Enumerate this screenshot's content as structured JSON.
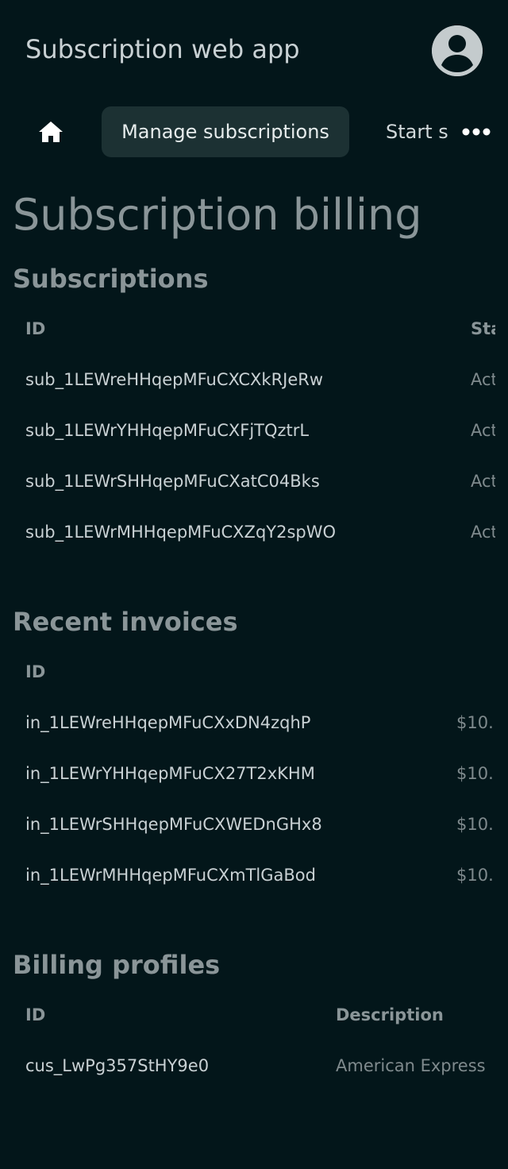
{
  "header": {
    "app_title": "Subscription web app",
    "avatar_icon": "account-circle-icon"
  },
  "nav": {
    "home_icon": "home-icon",
    "active_tab": "Manage subscriptions",
    "next_tab": "Start s",
    "more_icon": "more-horizontal-icon"
  },
  "page": {
    "title": "Subscription billing"
  },
  "subscriptions": {
    "title": "Subscriptions",
    "columns": [
      "ID",
      "Sta"
    ],
    "rows": [
      {
        "id": "sub_1LEWreHHqepMFuCXCXkRJeRw",
        "status": "Act"
      },
      {
        "id": "sub_1LEWrYHHqepMFuCXFjTQztrL",
        "status": "Act"
      },
      {
        "id": "sub_1LEWrSHHqepMFuCXatC04Bks",
        "status": "Act"
      },
      {
        "id": "sub_1LEWrMHHqepMFuCXZqY2spWO",
        "status": "Act"
      }
    ]
  },
  "invoices": {
    "title": "Recent invoices",
    "columns": [
      "ID"
    ],
    "rows": [
      {
        "id": "in_1LEWreHHqepMFuCXxDN4zqhP",
        "amount": "$10."
      },
      {
        "id": "in_1LEWrYHHqepMFuCX27T2xKHM",
        "amount": "$10."
      },
      {
        "id": "in_1LEWrSHHqepMFuCXWEDnGHx8",
        "amount": "$10."
      },
      {
        "id": "in_1LEWrMHHqepMFuCXmTlGaBod",
        "amount": "$10."
      }
    ]
  },
  "profiles": {
    "title": "Billing profiles",
    "columns": [
      "ID",
      "Description"
    ],
    "rows": [
      {
        "id": "cus_LwPg357StHY9e0",
        "description": "American Express"
      }
    ]
  },
  "colors": {
    "background": "#03161a",
    "active_tab_bg": "#1c3133",
    "heading": "#8a9598",
    "text": "#c9d1d4"
  }
}
